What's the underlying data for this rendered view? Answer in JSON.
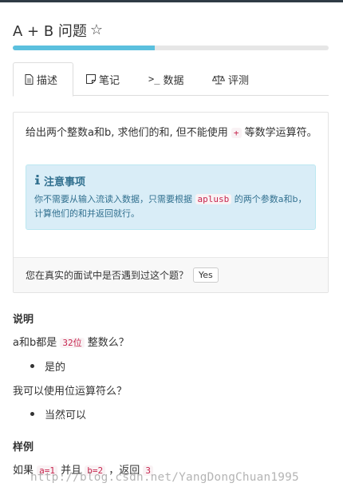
{
  "problem": {
    "title": "A + B 问题",
    "star_icon": "star-outline-icon",
    "progress_percent": 45
  },
  "tabs": [
    {
      "label": "描述",
      "icon": "file-text-icon",
      "active": true
    },
    {
      "label": "笔记",
      "icon": "note-icon",
      "active": false
    },
    {
      "label": "数据",
      "icon": "terminal-icon",
      "active": false
    },
    {
      "label": "评测",
      "icon": "balance-scale-icon",
      "active": false
    }
  ],
  "description": {
    "text_before": "给出两个整数a和b, 求他们的和, 但不能使用 ",
    "code": "+",
    "text_after": " 等数学运算符。"
  },
  "note": {
    "title": "注意事项",
    "body_before": "你不需要从输入流读入数据，只需要根据 ",
    "body_code": "aplusb",
    "body_after": " 的两个参数a和b，计算他们的和并返回就行。"
  },
  "interview": {
    "question": "您在真实的面试中是否遇到过这个题？",
    "yes_label": "Yes"
  },
  "explanation": {
    "heading": "说明",
    "q1_before": "a和b都是 ",
    "q1_code": "32位",
    "q1_after": " 整数么？",
    "a1": "是的",
    "q2": "我可以使用位运算符么？",
    "a2": "当然可以"
  },
  "example": {
    "heading": "样例",
    "prefix": "如果 ",
    "code_a": "a=1",
    "mid1": " 并且 ",
    "code_b": "b=2",
    "mid2": " ，返回 ",
    "code_result": "3"
  },
  "watermark": "http://blog.csdn.net/YangDongChuan1995",
  "colors": {
    "accent": "#5bc0de",
    "note_bg": "#d9edf7",
    "note_text": "#31708f",
    "code_text": "#c7254e"
  }
}
